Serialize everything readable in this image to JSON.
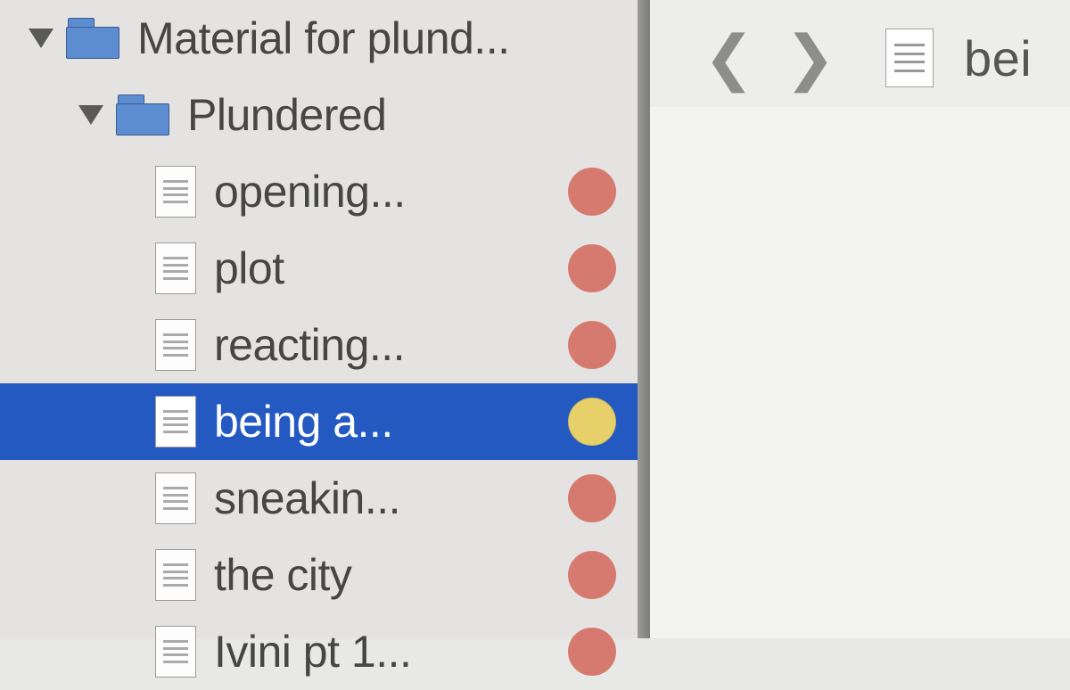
{
  "sidebar": {
    "tree": [
      {
        "label": "Material for plund...",
        "type": "folder",
        "depth": 0,
        "expanded": true,
        "status": null,
        "selected": false
      },
      {
        "label": "Plundered",
        "type": "folder",
        "depth": 1,
        "expanded": true,
        "status": null,
        "selected": false
      },
      {
        "label": "opening...",
        "type": "doc",
        "depth": 2,
        "status": "red",
        "selected": false
      },
      {
        "label": "plot",
        "type": "doc",
        "depth": 2,
        "status": "red",
        "selected": false
      },
      {
        "label": "reacting...",
        "type": "doc",
        "depth": 2,
        "status": "red",
        "selected": false
      },
      {
        "label": "being a...",
        "type": "doc",
        "depth": 2,
        "status": "yellow",
        "selected": true
      },
      {
        "label": "sneakin...",
        "type": "doc",
        "depth": 2,
        "status": "red",
        "selected": false
      },
      {
        "label": "the city",
        "type": "doc",
        "depth": 2,
        "status": "red",
        "selected": false
      },
      {
        "label": "Ivini pt 1...",
        "type": "doc",
        "depth": 2,
        "status": "red",
        "selected": false
      }
    ]
  },
  "editor": {
    "crumb_title": "bei"
  }
}
